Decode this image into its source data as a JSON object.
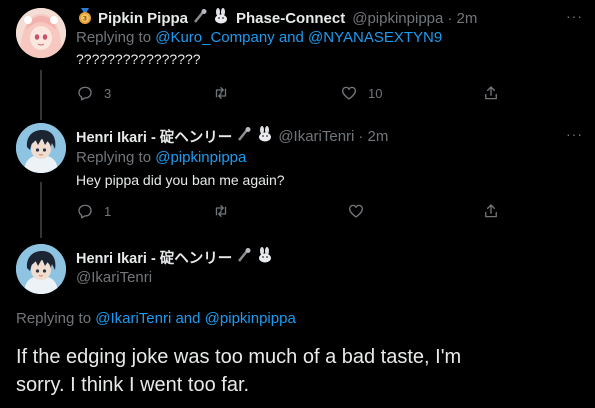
{
  "tweets": [
    {
      "name": "Pipkin Pippa",
      "affiliation": "Phase-Connect",
      "handle": "@pipkinpippa",
      "time": "· 2m",
      "replying_prefix": "Replying to",
      "replying_to_1": "@Kuro_Company",
      "replying_and": "and",
      "replying_to_2": "@NYANASEXTYN9",
      "text": "????????????????",
      "actions": {
        "replies": "3",
        "retweets": "",
        "likes": "10"
      }
    },
    {
      "name": "Henri Ikari - 碇ヘンリー",
      "handle": "@IkariTenri",
      "time": "· 2m",
      "replying_prefix": "Replying to",
      "replying_to_1": "@pipkinpippa",
      "text": "Hey pippa did you ban me again?",
      "actions": {
        "replies": "1",
        "retweets": "",
        "likes": ""
      }
    }
  ],
  "focused": {
    "name": "Henri Ikari - 碇ヘンリー",
    "handle": "@IkariTenri",
    "replying_prefix": "Replying to",
    "replying_to_1": "@IkariTenri",
    "replying_and": "and",
    "replying_to_2": "@pipkinpippa",
    "text_line1": "If the edging joke was too much of a bad taste, I'm",
    "text_line2": "sorry. I think I went too far."
  },
  "more_glyph": "···",
  "colors": {
    "background": "#000000",
    "text": "#e7e9ea",
    "muted": "#71767b",
    "link": "#1d9bf0",
    "thread_line": "#333639"
  }
}
